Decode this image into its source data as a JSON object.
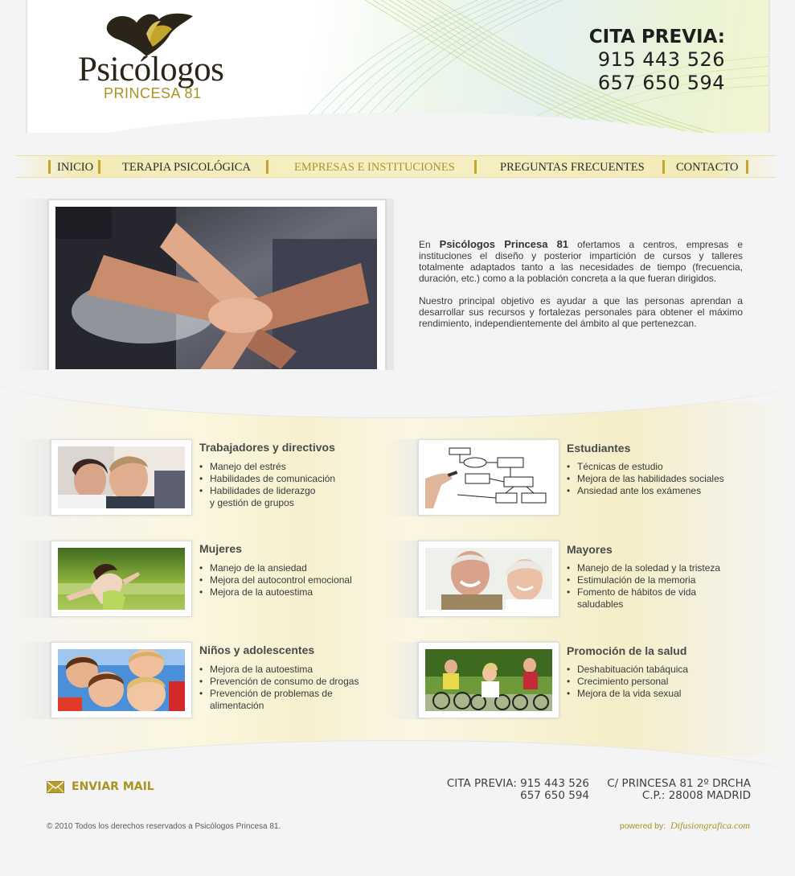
{
  "header": {
    "logo_name": "Psicólogos",
    "logo_subtitle": "PRINCESA 81",
    "cita_title": "CITA PREVIA:",
    "phone_1": "915 443 526",
    "phone_2": "657 650 594"
  },
  "nav": {
    "items": [
      {
        "label": "INICIO"
      },
      {
        "label": "TERAPIA PSICOLÓGICA"
      },
      {
        "label": "EMPRESAS E INSTITUCIONES",
        "active": true
      },
      {
        "label": "PREGUNTAS FRECUENTES"
      },
      {
        "label": "CONTACTO"
      }
    ]
  },
  "intro": {
    "p1_pre": "En",
    "p1_brand": "Psicólogos Princesa 81",
    "p1_post": "ofertamos a centros, empresas e instituciones el diseño y posterior impartición de cursos y talleres totalmente adaptados tanto a las necesidades de tiempo (frecuencia, duración, etc.) como a la población concreta a la que fueran dirigidos.",
    "p2": "Nuestro principal objetivo es ayudar a que las personas aprendan a desarrollar sus recursos y fortalezas personales para obtener el máximo rendimiento, independientemente del ámbito al que pertenezcan."
  },
  "services": [
    {
      "title": "Trabajadores y directivos",
      "items": [
        "Manejo del estrés",
        "Habilidades de comunicación",
        "Habilidades de liderazgo\n y gestión de grupos"
      ]
    },
    {
      "title": "Estudiantes",
      "items": [
        "Técnicas de estudio",
        "Mejora de las habilidades sociales",
        "Ansiedad ante los exámenes"
      ]
    },
    {
      "title": "Mujeres",
      "items": [
        "Manejo de la ansiedad",
        "Mejora del autocontrol emocional",
        "Mejora de la autoestima"
      ]
    },
    {
      "title": "Mayores",
      "items": [
        "Manejo de la soledad y la tristeza",
        "Estimulación de la memoria",
        "Fomento de hábitos de vida\n saludables"
      ]
    },
    {
      "title": "Niños y adolescentes",
      "items": [
        "Mejora de la autoestima",
        "Prevención de consumo de drogas",
        "Prevención de problemas de\n alimentación"
      ]
    },
    {
      "title": "Promoción de la salud",
      "items": [
        "Deshabituación tabáquica",
        "Crecimiento personal",
        "Mejora de la vida sexual"
      ]
    }
  ],
  "footer": {
    "mail_label": "ENVIAR MAIL",
    "cita_line_1": "CITA PREVIA: 915 443 526",
    "cita_line_2": "657 650 594",
    "address_1": "C/ PRINCESA 81 2º DRCHA",
    "address_2": "C.P.: 28008 MADRID",
    "copyright": "© 2010 Todos los derechos reservados a Psicólogos Princesa 81.",
    "powered_label": "powered by:",
    "powered_brand": "Difusiongrafica.com"
  },
  "colors": {
    "accent_gold": "#a99323",
    "nav_band": "#f6efc3",
    "page_bg": "#f4f4f4"
  }
}
